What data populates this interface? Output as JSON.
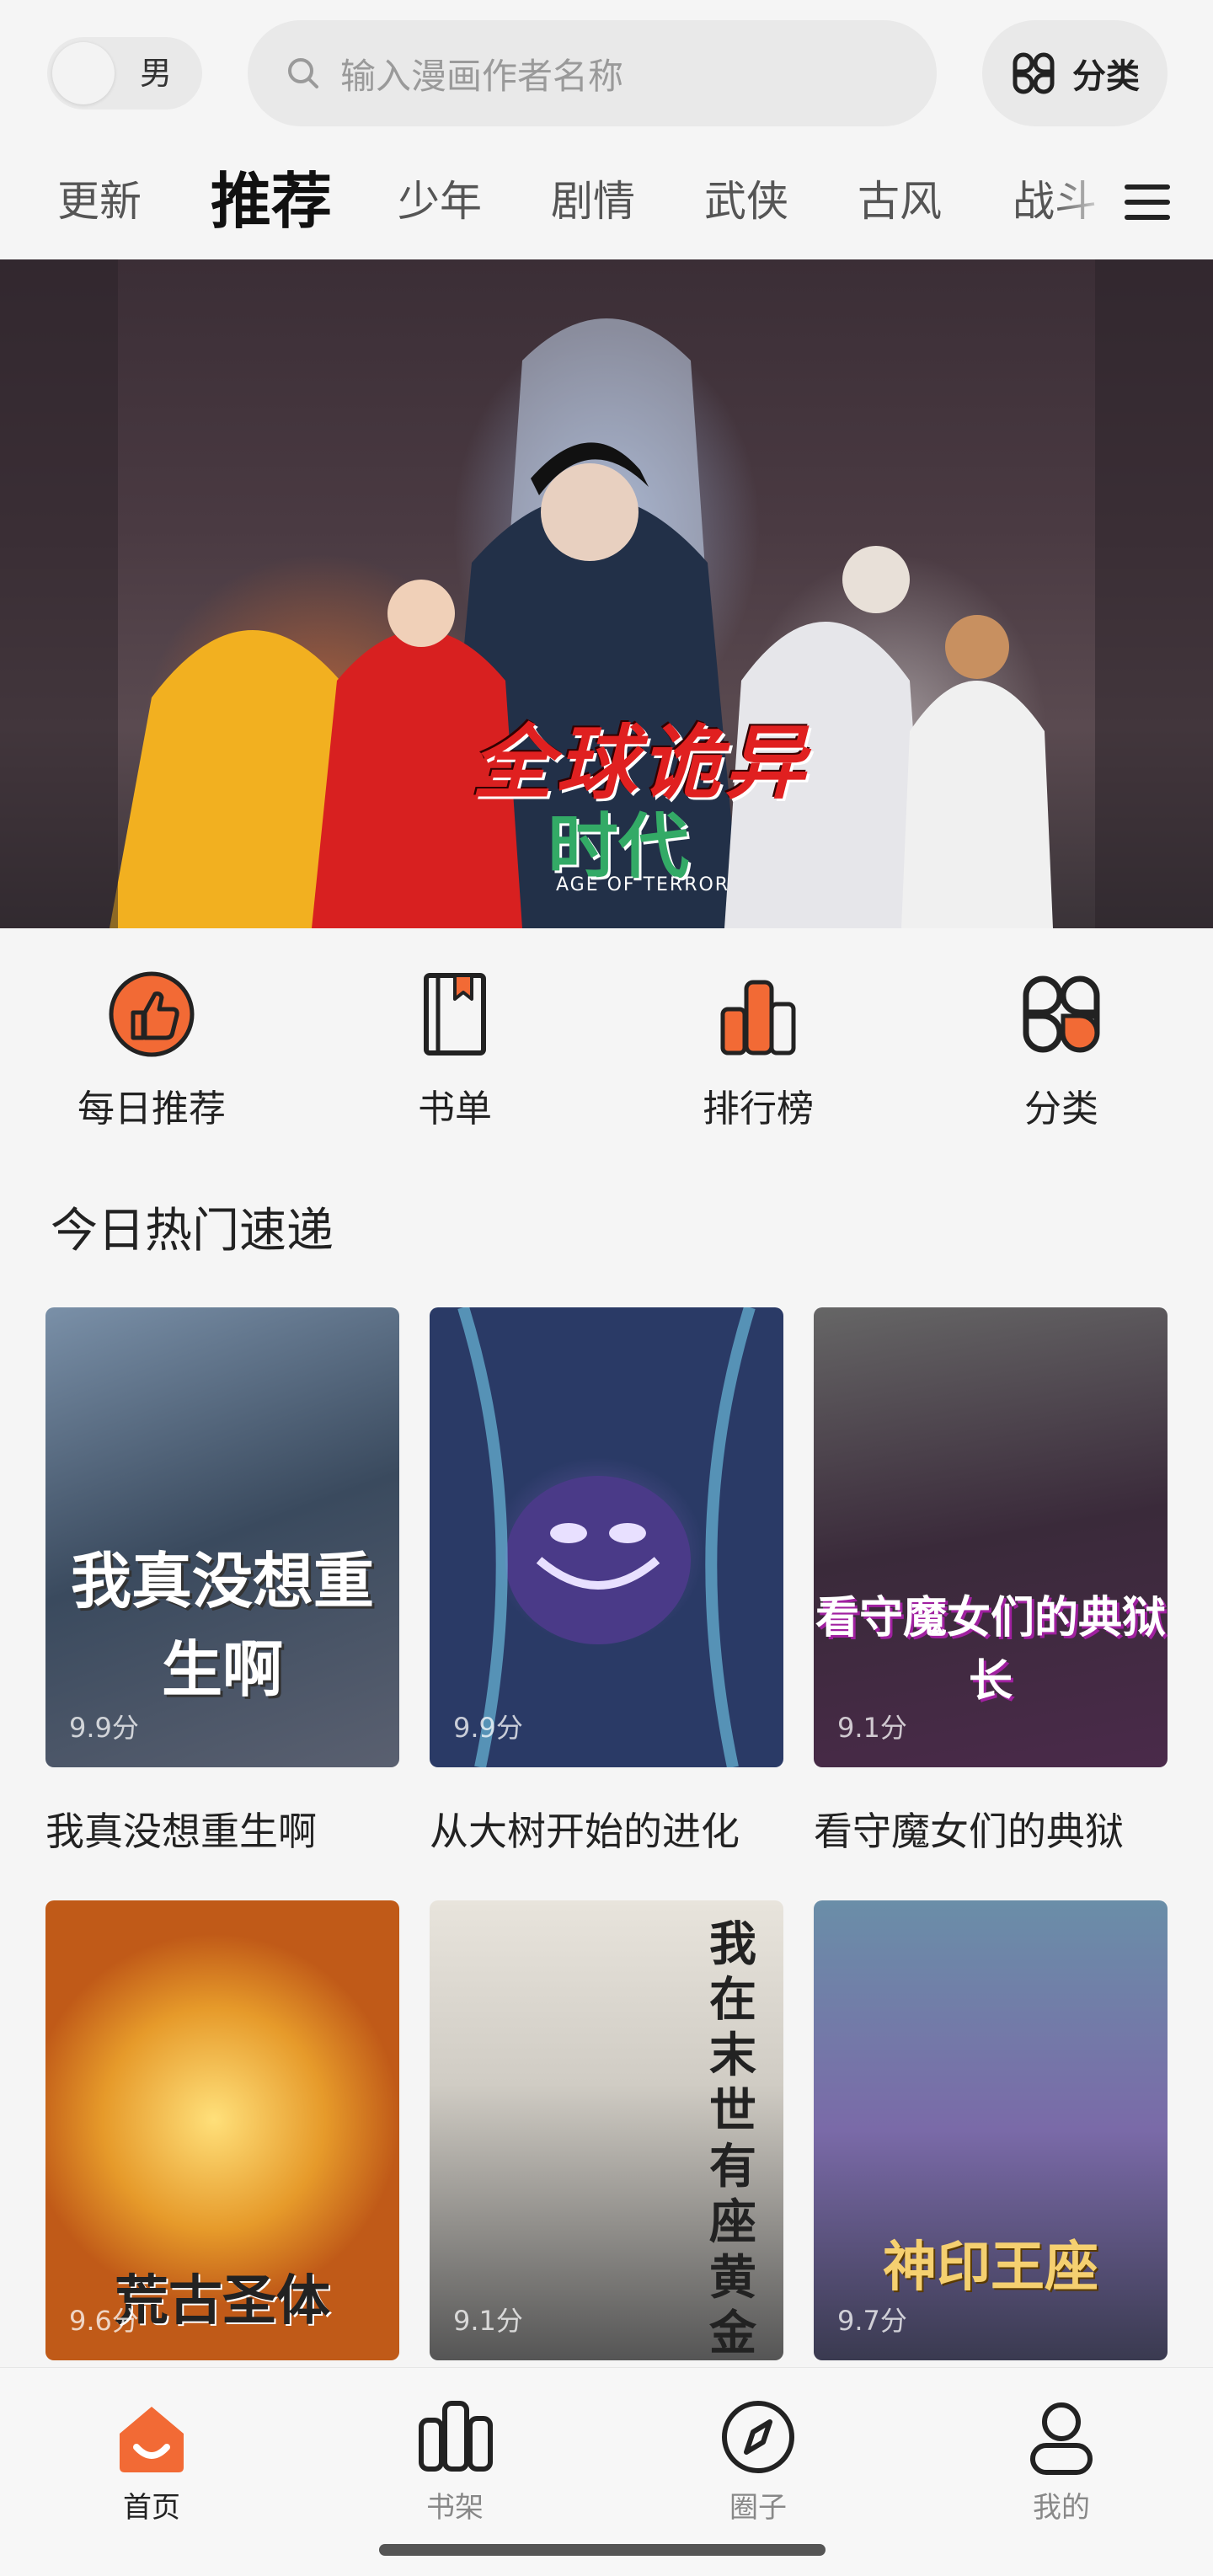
{
  "top": {
    "gender": "男",
    "search_placeholder": "输入漫画作者名称",
    "category_label": "分类"
  },
  "tabs": [
    "更新",
    "推荐",
    "少年",
    "剧情",
    "武侠",
    "古风",
    "战斗"
  ],
  "active_tab": "推荐",
  "banner": {
    "title_line1": "全球诡异",
    "title_line2": "时代",
    "subtitle": "AGE OF TERROR"
  },
  "quick_entries": [
    {
      "label": "每日推荐",
      "icon": "thumbs-up-icon"
    },
    {
      "label": "书单",
      "icon": "bookmark-book-icon"
    },
    {
      "label": "排行榜",
      "icon": "ranking-bars-icon"
    },
    {
      "label": "分类",
      "icon": "category-grid-icon"
    }
  ],
  "section": {
    "title": "今日热门速递",
    "items": [
      {
        "title": "我真没想重生啊",
        "score": "9.9分",
        "cover_text": "我真没想重生啊"
      },
      {
        "title": "从大树开始的进化",
        "score": "9.9分",
        "cover_text": ""
      },
      {
        "title": "看守魔女们的典狱",
        "score": "9.1分",
        "cover_text": "看守魔女们的典狱长"
      },
      {
        "title": "",
        "score": "9.6分",
        "cover_text": "荒古圣体"
      },
      {
        "title": "",
        "score": "9.1分",
        "cover_text": "我在末世有座黄金宫"
      },
      {
        "title": "",
        "score": "9.7分",
        "cover_text": "神印王座"
      }
    ]
  },
  "bottom_nav": [
    {
      "label": "首页",
      "icon": "home-icon",
      "active": true
    },
    {
      "label": "书架",
      "icon": "bookshelf-icon",
      "active": false
    },
    {
      "label": "圈子",
      "icon": "compass-icon",
      "active": false
    },
    {
      "label": "我的",
      "icon": "profile-icon",
      "active": false
    }
  ],
  "colors": {
    "accent": "#f26a35",
    "background": "#f5f5f5"
  }
}
